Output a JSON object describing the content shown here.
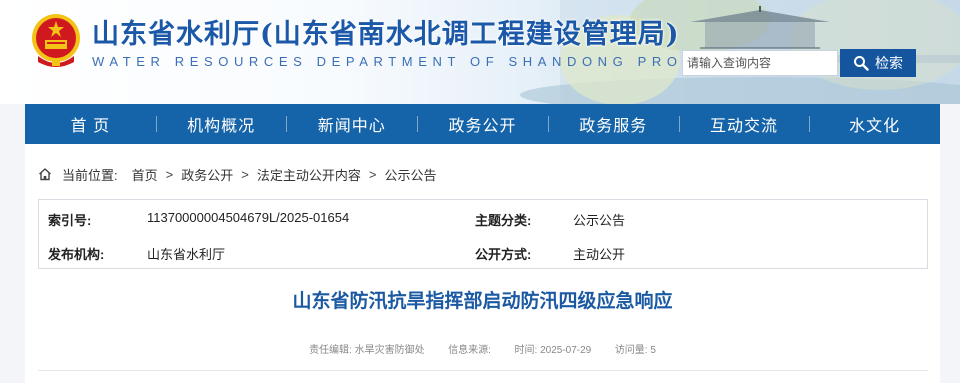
{
  "header": {
    "title": "山东省水利厅(山东省南水北调工程建设管理局)",
    "subtitle": "WATER RESOURCES DEPARTMENT OF SHANDONG PROVINCE",
    "search_placeholder": "请输入查询内容",
    "search_button": "检索"
  },
  "nav": {
    "items": [
      "首 页",
      "机构概况",
      "新闻中心",
      "政务公开",
      "政务服务",
      "互动交流",
      "水文化"
    ]
  },
  "breadcrumb": {
    "label": "当前位置:",
    "items": [
      "首页",
      "政务公开",
      "法定主动公开内容",
      "公示公告"
    ],
    "separator": ">"
  },
  "meta": {
    "index_label": "索引号:",
    "index_value": "11370000004504679L/2025-01654",
    "topic_label": "主题分类:",
    "topic_value": "公示公告",
    "publisher_label": "发布机构:",
    "publisher_value": "山东省水利厅",
    "method_label": "公开方式:",
    "method_value": "主动公开"
  },
  "article": {
    "title": "山东省防汛抗旱指挥部启动防汛四级应急响应",
    "editor_label": "责任编辑:",
    "editor_value": "水旱灾害防御处",
    "source_label": "信息来源:",
    "source_value": "",
    "time_label": "时间:",
    "time_value": "2025-07-29",
    "views_label": "访问量:",
    "views_value": "5"
  },
  "colors": {
    "nav_blue": "#1563a8",
    "title_blue": "#1b58a8",
    "article_title_blue": "#1b5aa3",
    "emblem_red": "#d0191f",
    "emblem_gold": "#f3c316"
  },
  "icons": {
    "emblem": "national-emblem-icon",
    "search": "search-icon",
    "home": "home-icon"
  }
}
